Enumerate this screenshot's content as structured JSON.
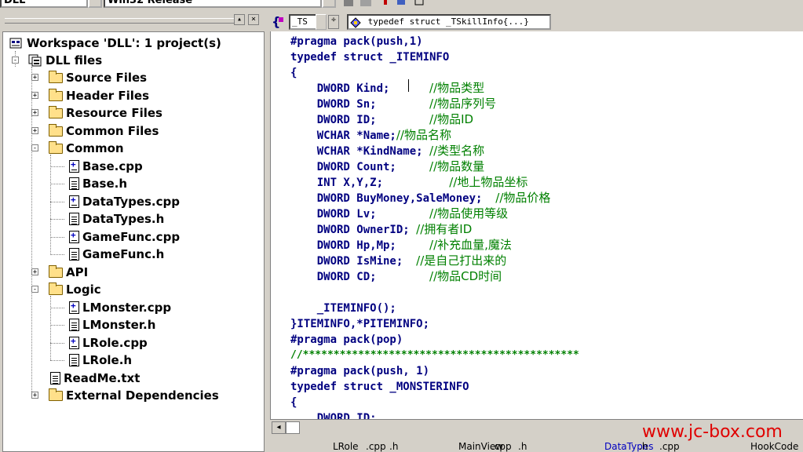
{
  "toolbar": {
    "project_combo": "DLL",
    "config_combo": "Win32 Release"
  },
  "workspace": {
    "root": "Workspace 'DLL': 1 project(s)",
    "project": "DLL files",
    "items": [
      {
        "label": "Source Files",
        "type": "folder",
        "expander": "+"
      },
      {
        "label": "Header Files",
        "type": "folder",
        "expander": "+"
      },
      {
        "label": "Resource Files",
        "type": "folder",
        "expander": "+"
      },
      {
        "label": "Common Files",
        "type": "folder",
        "expander": "+"
      },
      {
        "label": "Common",
        "type": "folder",
        "expander": "-"
      },
      {
        "label": "Base.cpp",
        "type": "cpp"
      },
      {
        "label": "Base.h",
        "type": "h"
      },
      {
        "label": "DataTypes.cpp",
        "type": "cpp"
      },
      {
        "label": "DataTypes.h",
        "type": "h"
      },
      {
        "label": "GameFunc.cpp",
        "type": "cpp"
      },
      {
        "label": "GameFunc.h",
        "type": "h"
      },
      {
        "label": "API",
        "type": "folder",
        "expander": "+"
      },
      {
        "label": "Logic",
        "type": "folder",
        "expander": "-"
      },
      {
        "label": "LMonster.cpp",
        "type": "cpp"
      },
      {
        "label": "LMonster.h",
        "type": "h"
      },
      {
        "label": "LRole.cpp",
        "type": "cpp"
      },
      {
        "label": "LRole.h",
        "type": "h"
      },
      {
        "label": "ReadMe.txt",
        "type": "h"
      },
      {
        "label": "External Dependencies",
        "type": "folder",
        "expander": "+"
      }
    ]
  },
  "editor": {
    "class_combo": "_TS",
    "member_combo": "typedef struct _TSkillInfo{...}",
    "lines": [
      {
        "code": "#pragma pack(push,1)",
        "comment": ""
      },
      {
        "code": "typedef struct _ITEMINFO",
        "comment": ""
      },
      {
        "code": "{",
        "comment": ""
      },
      {
        "code": "    DWORD Kind;      ",
        "comment": "//物品类型"
      },
      {
        "code": "    DWORD Sn;        ",
        "comment": "//物品序列号"
      },
      {
        "code": "    DWORD ID;        ",
        "comment": "//物品ID"
      },
      {
        "code": "    WCHAR *Name;",
        "comment": "//物品名称"
      },
      {
        "code": "    WCHAR *KindName; ",
        "comment": "//类型名称"
      },
      {
        "code": "    DWORD Count;     ",
        "comment": "//物品数量"
      },
      {
        "code": "    INT X,Y,Z;          ",
        "comment": "//地上物品坐标"
      },
      {
        "code": "    DWORD BuyMoney,SaleMoney;  ",
        "comment": "//物品价格"
      },
      {
        "code": "    DWORD Lv;        ",
        "comment": "//物品使用等级"
      },
      {
        "code": "    DWORD OwnerID; ",
        "comment": "//拥有者ID"
      },
      {
        "code": "    DWORD Hp,Mp;     ",
        "comment": "//补充血量,魔法"
      },
      {
        "code": "    DWORD IsMine;  ",
        "comment": "//是自己打出来的"
      },
      {
        "code": "    DWORD CD;        ",
        "comment": "//物品CD时间"
      },
      {
        "code": "",
        "comment": ""
      },
      {
        "code": "    _ITEMINFO();",
        "comment": ""
      },
      {
        "code": "}ITEMINFO,*PITEMINFO;",
        "comment": ""
      },
      {
        "code": "#pragma pack(pop)",
        "comment": ""
      },
      {
        "code": "",
        "comment": "//*********************************************"
      },
      {
        "code": "#pragma pack(push, 1)",
        "comment": ""
      },
      {
        "code": "typedef struct _MONSTERINFO",
        "comment": ""
      },
      {
        "code": "{",
        "comment": ""
      },
      {
        "code": "    DWORD ID;",
        "comment": ""
      }
    ]
  },
  "tabs": [
    {
      "label": "LRole",
      "blue": false
    },
    {
      "label": ".cpp",
      "blue": false
    },
    {
      "label": ".h",
      "blue": false
    },
    {
      "label": "MainView",
      "blue": false
    },
    {
      "label": ".cpp",
      "blue": false
    },
    {
      "label": ".h",
      "blue": false
    },
    {
      "label": "DataTypes",
      "blue": true
    },
    {
      "label": ".h",
      "blue": false
    },
    {
      "label": ".cpp",
      "blue": false
    },
    {
      "label": "HookCode",
      "blue": false
    }
  ],
  "watermark": "www.jc-box.com"
}
